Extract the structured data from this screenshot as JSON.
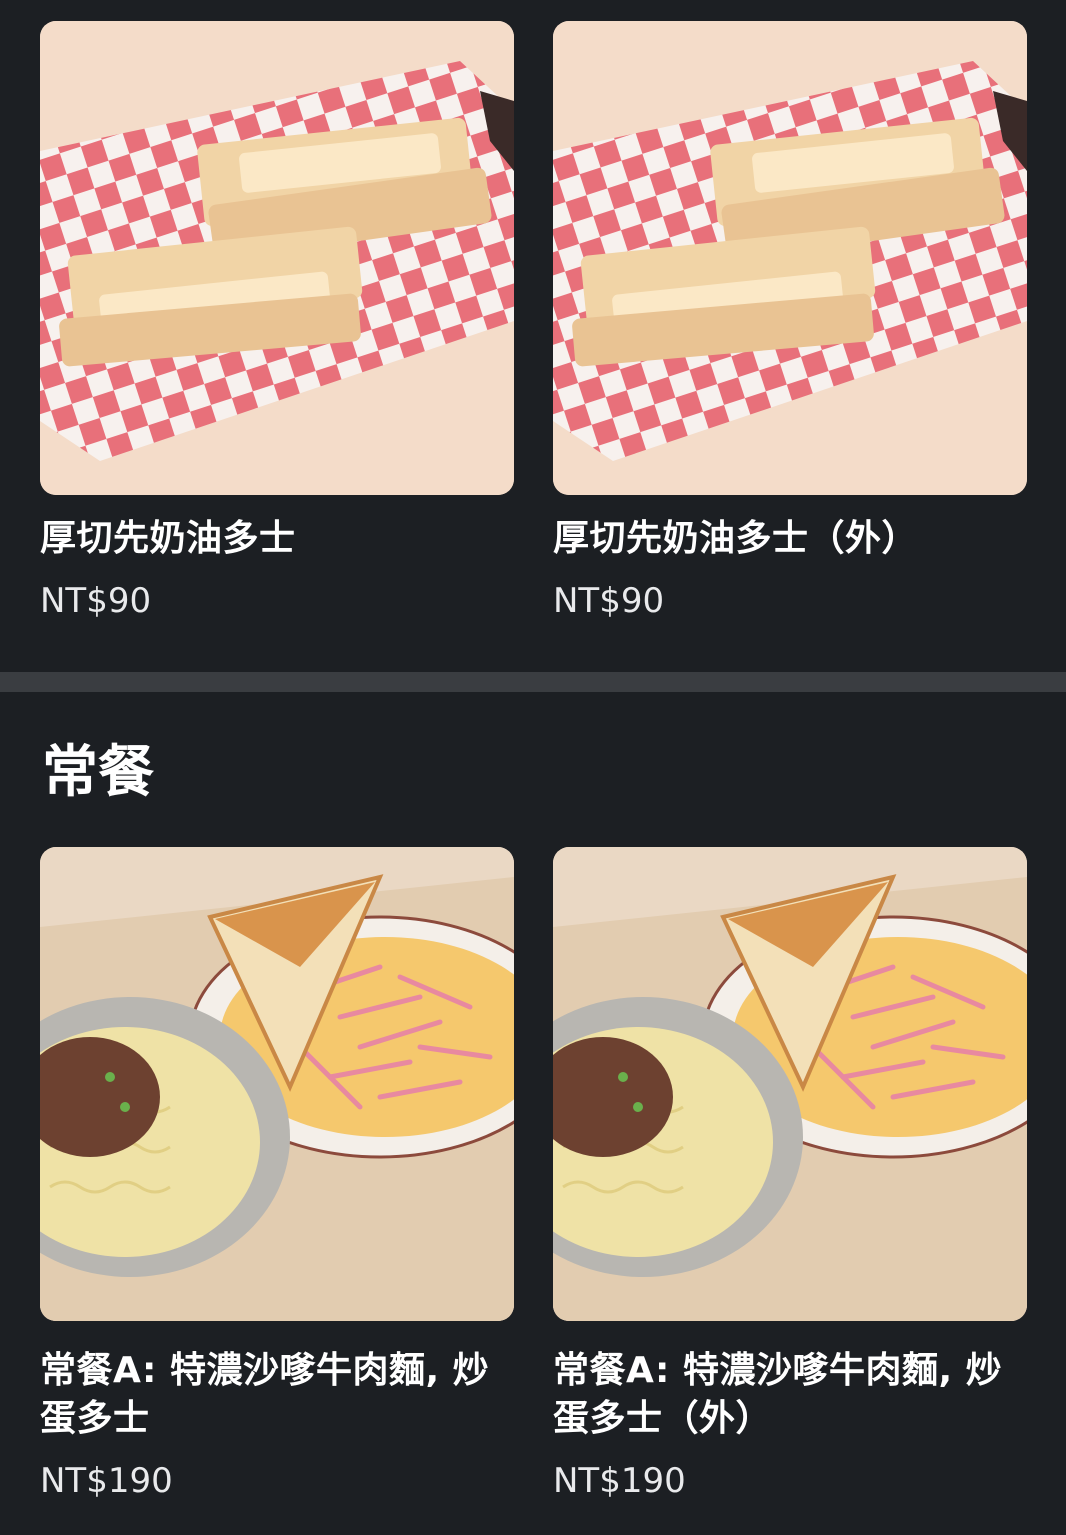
{
  "sections": [
    {
      "items": [
        {
          "name": "厚切先奶油多士",
          "price": "NT$90"
        },
        {
          "name": "厚切先奶油多士（外）",
          "price": "NT$90"
        }
      ]
    },
    {
      "title": "常餐",
      "items": [
        {
          "name": "常餐A: 特濃沙嗲牛肉麵, 炒蛋多士",
          "price": "NT$190"
        },
        {
          "name": "常餐A: 特濃沙嗲牛肉麵, 炒蛋多士（外）",
          "price": "NT$190"
        }
      ]
    }
  ],
  "icons": {
    "toast_photo": "toast-basket-photo",
    "set_meal_photo": "set-meal-tray-photo"
  },
  "colors": {
    "background": "#1c1f23",
    "divider": "#3a3d41",
    "text": "#ffffff"
  }
}
